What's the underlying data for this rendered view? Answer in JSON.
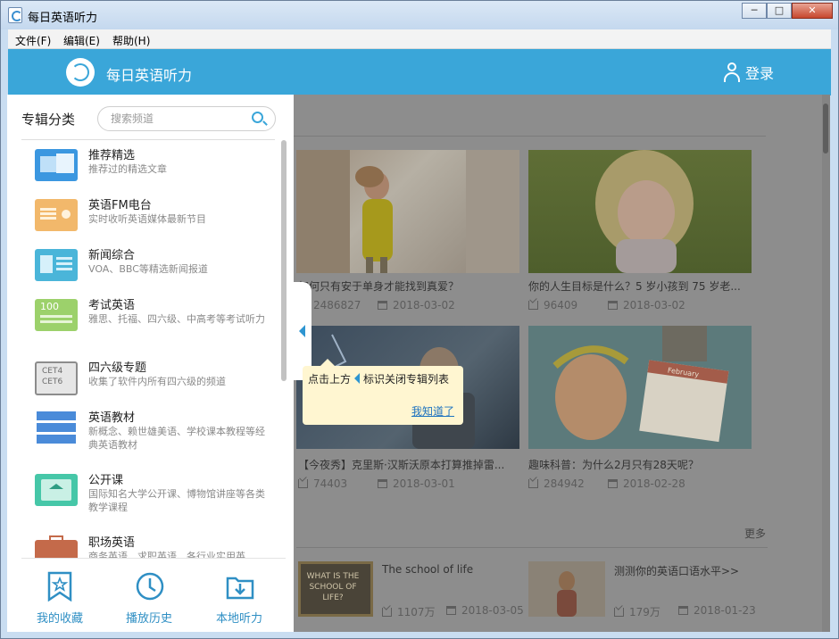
{
  "window": {
    "title": "每日英语听力",
    "min": "─",
    "max": "□",
    "close": "✕"
  },
  "menu": {
    "file": "文件(F)",
    "edit": "编辑(E)",
    "help": "帮助(H)"
  },
  "header": {
    "app_name": "每日英语听力",
    "login": "登录"
  },
  "sidebar": {
    "title": "专辑分类",
    "search_placeholder": "搜索频道",
    "categories": [
      {
        "title": "推荐精选",
        "desc": "推荐过的精选文章",
        "icon": "recommend-icon",
        "color": "#3b97e0"
      },
      {
        "title": "英语FM电台",
        "desc": "实时收听英语媒体最新节目",
        "icon": "radio-icon",
        "color": "#f2b86b"
      },
      {
        "title": "新闻综合",
        "desc": "VOA、BBC等精选新闻报道",
        "icon": "news-icon",
        "color": "#4ab5d9"
      },
      {
        "title": "考试英语",
        "desc": "雅思、托福、四六级、中高考等考试听力",
        "icon": "exam-icon",
        "color": "#9cd16b",
        "icon_text": "100"
      },
      {
        "title": "四六级专题",
        "desc": "收集了软件内所有四六级的频道",
        "icon": "cet-icon",
        "color": "#8c8c8c",
        "icon_text1": "CET4",
        "icon_text2": "CET6"
      },
      {
        "title": "英语教材",
        "desc": "新概念、赖世雄美语、学校课本教程等经典英语教材",
        "icon": "textbook-icon",
        "color": "#4a8bd9"
      },
      {
        "title": "公开课",
        "desc": "国际知名大学公开课、博物馆讲座等各类教学课程",
        "icon": "open-course-icon",
        "color": "#46c7a8"
      },
      {
        "title": "职场英语",
        "desc": "商务英语、求职英语、各行业实用英",
        "icon": "briefcase-icon",
        "color": "#c46a4a"
      }
    ],
    "tabs": [
      {
        "label": "我的收藏",
        "icon": "bookmark-star-icon"
      },
      {
        "label": "播放历史",
        "icon": "clock-icon"
      },
      {
        "label": "本地听力",
        "icon": "download-folder-icon"
      }
    ]
  },
  "tooltip": {
    "text_before": "点击上方",
    "text_after": "标识关闭专辑列表",
    "link": "我知道了"
  },
  "articles": [
    {
      "title": "如何只有安于单身才能找到真爱？",
      "downloads": "2486827",
      "date": "2018-03-02"
    },
    {
      "title": "你的人生目标是什么？5 岁小孩到 75 岁老...",
      "downloads": "96409",
      "date": "2018-03-02"
    },
    {
      "title": "【今夜秀】克里斯·汉斯沃原本打算推掉雷...",
      "downloads": "74403",
      "date": "2018-03-01"
    },
    {
      "title": "趣味科普：为什么2月只有28天呢？",
      "downloads": "284942",
      "date": "2018-02-28"
    }
  ],
  "calendar_card": "February",
  "more": "更多",
  "small_items": [
    {
      "title": "The school of life",
      "downloads": "1107万",
      "date": "2018-03-05",
      "thumb_text": "WHAT IS THE SCHOOL OF LIFE?"
    },
    {
      "title": "测测你的英语口语水平>>",
      "downloads": "179万",
      "date": "2018-01-23"
    }
  ]
}
